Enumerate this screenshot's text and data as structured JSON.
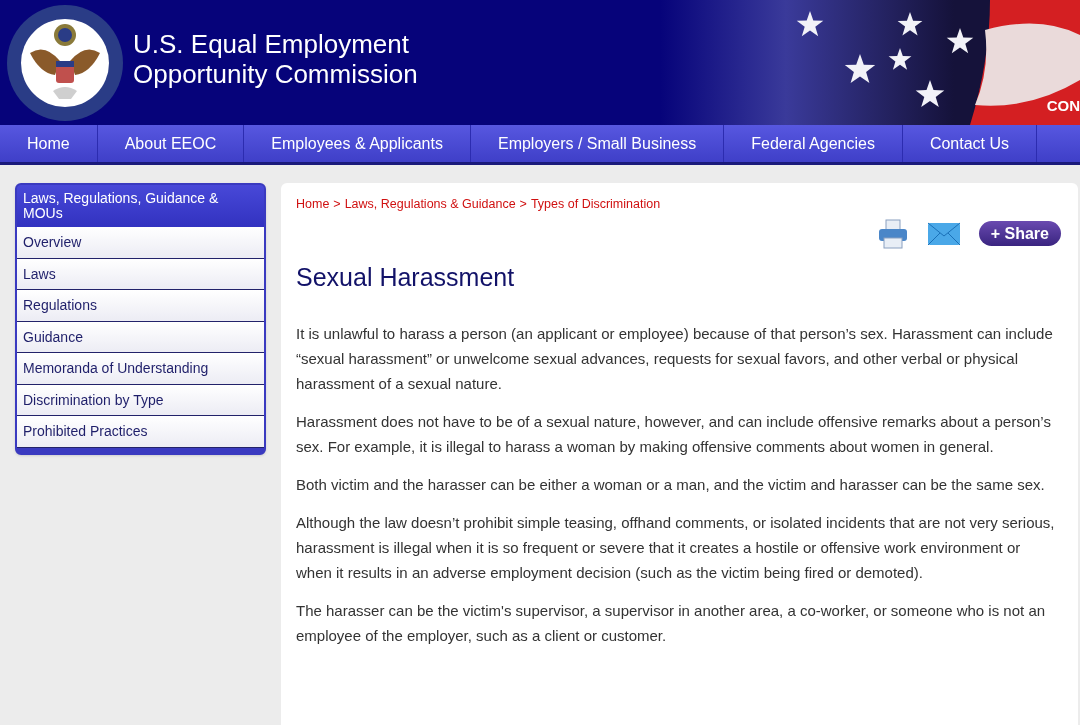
{
  "header": {
    "title_lines": [
      "U.S. Equal Employment",
      "Opportunity Commission"
    ],
    "corner_link": "CON"
  },
  "nav": [
    {
      "label": "Home"
    },
    {
      "label": "About EEOC"
    },
    {
      "label": "Employees & Applicants"
    },
    {
      "label": "Employers / Small Business"
    },
    {
      "label": "Federal Agencies"
    },
    {
      "label": "Contact Us"
    }
  ],
  "sidebar": {
    "title": "Laws, Regulations, Guidance & MOUs",
    "items": [
      "Overview",
      "Laws",
      "Regulations",
      "Guidance",
      "Memoranda of Understanding",
      "Discrimination by Type",
      "Prohibited Practices"
    ]
  },
  "breadcrumb": {
    "separator": ">",
    "items": [
      "Home",
      "Laws, Regulations & Guidance",
      "Types of Discrimination"
    ]
  },
  "share_button": "+ Share",
  "heading": "Sexual Harassment",
  "paragraphs": [
    "It is unlawful to harass a person (an applicant or employee) because of that person’s sex. Harassment can include “sexual harassment” or unwelcome sexual advances, requests for sexual favors, and other verbal or physical harassment of a sexual nature.",
    "Harassment does not have to be of a sexual nature, however, and can include offensive remarks about a person’s sex. For example, it is illegal to harass a woman by making offensive comments about women in general.",
    "Both victim and the harasser can be either a woman or a man, and the victim and harasser can be the same sex.",
    "Although the law doesn’t prohibit simple teasing, offhand comments, or isolated incidents that are not very serious, harassment is illegal when it is so frequent or severe that it creates a hostile or offensive work environment or when it results in an adverse employment decision (such as the victim being fired or demoted).",
    "The harasser can be the victim's supervisor, a supervisor in another area, a co-worker, or someone who is not an employee of the employer, such as a client or customer."
  ]
}
